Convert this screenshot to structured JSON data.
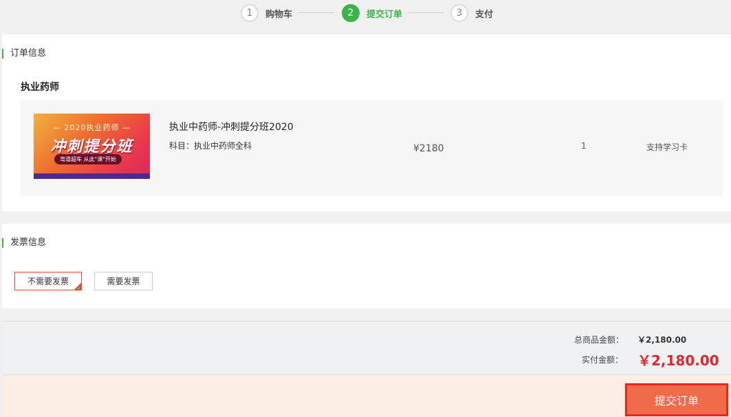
{
  "steps": [
    {
      "num": "1",
      "label": "购物车"
    },
    {
      "num": "2",
      "label": "提交订单"
    },
    {
      "num": "3",
      "label": "支付"
    }
  ],
  "order": {
    "title": "订单信息",
    "category": "执业药师",
    "item": {
      "banner_top": "— 2020执业药师 —",
      "banner_main": "冲刺提分班",
      "banner_sub": "弯道超车  从此\"课\"开始",
      "name": "执业中药师-冲刺提分班2020",
      "subject": "科目：执业中药师全科",
      "price": "¥2180",
      "quantity": "1",
      "card_support": "支持学习卡"
    }
  },
  "invoice": {
    "title": "发票信息",
    "options": [
      "不需要发票",
      "需要发票"
    ],
    "selected": "不需要发票"
  },
  "summary": {
    "total_label": "总商品金额：",
    "total_value": "￥2,180.00",
    "pay_label": "实付金额：",
    "pay_value": "￥2,180.00"
  },
  "submit_label": "提交订单",
  "colors": {
    "accent": "#3db44a",
    "price_red": "#e3262d",
    "button": "#f06b4a"
  }
}
